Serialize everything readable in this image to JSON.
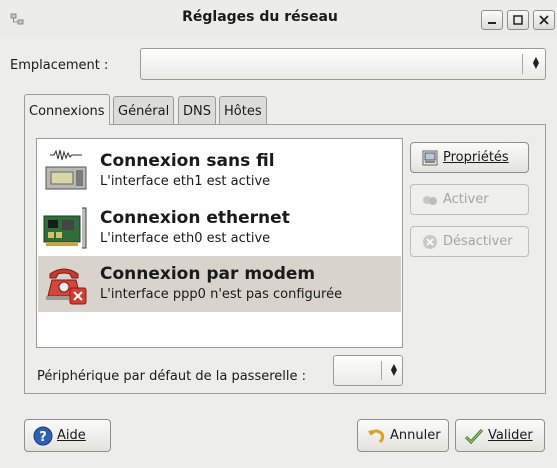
{
  "window": {
    "title": "Réglages du réseau",
    "buttons": {
      "minimize": "_",
      "maximize": "□",
      "close": "×"
    }
  },
  "location": {
    "label": "Emplacement :",
    "value": ""
  },
  "tabs": [
    {
      "label": "Connexions",
      "active": true
    },
    {
      "label": "Général",
      "active": false
    },
    {
      "label": "DNS",
      "active": false
    },
    {
      "label": "Hôtes",
      "active": false
    }
  ],
  "connections": [
    {
      "title": "Connexion sans fil",
      "subtitle": "L'interface eth1 est active",
      "icon": "wireless-card-icon",
      "selected": false
    },
    {
      "title": "Connexion ethernet",
      "subtitle": "L'interface eth0 est active",
      "icon": "ethernet-card-icon",
      "selected": false
    },
    {
      "title": "Connexion par modem",
      "subtitle": "L'interface ppp0 n'est pas configurée",
      "icon": "modem-phone-icon",
      "selected": true
    }
  ],
  "side_buttons": {
    "properties": {
      "label": "Propriétés",
      "enabled": true,
      "icon": "properties-icon"
    },
    "activate": {
      "label": "Activer",
      "enabled": false,
      "icon": "activate-icon"
    },
    "deactivate": {
      "label": "Désactiver",
      "enabled": false,
      "icon": "deactivate-icon"
    }
  },
  "gateway": {
    "label": "Périphérique par défaut de la passerelle :",
    "value": ""
  },
  "bottom_buttons": {
    "help": {
      "label": "Aide",
      "icon": "help-icon"
    },
    "cancel": {
      "label": "Annuler",
      "icon": "undo-icon"
    },
    "ok": {
      "label": "Valider",
      "icon": "checkmark-icon"
    }
  },
  "colors": {
    "window_bg": "#ededeb",
    "selected_row": "#d8d4cd",
    "disabled_text": "#a4a4a0"
  }
}
